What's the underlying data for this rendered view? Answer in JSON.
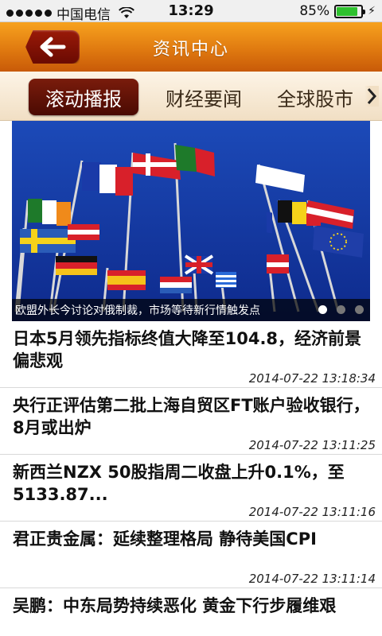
{
  "status_bar": {
    "carrier": "中国电信",
    "time": "13:29",
    "battery_percent_text": "85%",
    "battery_level": 0.85
  },
  "header": {
    "title": "资讯中心",
    "back_icon": "back-arrow-icon"
  },
  "tabs": [
    {
      "label": "滚动播报",
      "active": true
    },
    {
      "label": "财经要闻",
      "active": false
    },
    {
      "label": "全球股市",
      "active": false
    }
  ],
  "banner": {
    "caption": "欧盟外长今讨论对俄制裁，市场等待新行情触发点",
    "pager_count": 3,
    "pager_active": 0
  },
  "news": [
    {
      "title": "日本5月领先指标终值大降至104.8，经济前景偏悲观",
      "time": "2014-07-22 13:18:34"
    },
    {
      "title": "央行正评估第二批上海自贸区FT账户验收银行，8月或出炉",
      "time": "2014-07-22 13:11:25"
    },
    {
      "title": "新西兰NZX 50股指周二收盘上升0.1%，至5133.87...",
      "time": "2014-07-22 13:11:16"
    },
    {
      "title": "君正贵金属：延续整理格局 静待美国CPI",
      "time": "2014-07-22 13:11:14"
    },
    {
      "title": "吴鹏：中东局势持续恶化 黄金下行步履维艰",
      "time": ""
    }
  ],
  "colors": {
    "header_orange": "#e07a10",
    "active_tab": "#6a120a",
    "tab_bar_bg": "#f5e6cf",
    "battery_green": "#2ec12e"
  }
}
